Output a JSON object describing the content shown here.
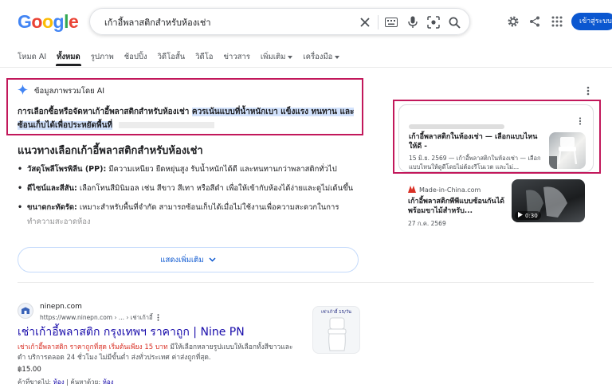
{
  "header": {
    "logo_letters": [
      {
        "ch": "G",
        "color": "#4285F4"
      },
      {
        "ch": "o",
        "color": "#EA4335"
      },
      {
        "ch": "o",
        "color": "#FBBC05"
      },
      {
        "ch": "g",
        "color": "#4285F4"
      },
      {
        "ch": "l",
        "color": "#34A853"
      },
      {
        "ch": "e",
        "color": "#EA4335"
      }
    ],
    "search_value": "เก้าอี้พลาสติกสำหรับห้องเช่า",
    "signin_label": "เข้าสู่ระบบ"
  },
  "tabs": [
    {
      "label": "โหมด AI",
      "active": false,
      "dropdown": false
    },
    {
      "label": "ทั้งหมด",
      "active": true,
      "dropdown": false
    },
    {
      "label": "รูปภาพ",
      "active": false,
      "dropdown": false
    },
    {
      "label": "ช้อปปิ้ง",
      "active": false,
      "dropdown": false
    },
    {
      "label": "วิดีโอสั้น",
      "active": false,
      "dropdown": false
    },
    {
      "label": "วิดีโอ",
      "active": false,
      "dropdown": false
    },
    {
      "label": "ข่าวสาร",
      "active": false,
      "dropdown": false
    },
    {
      "label": "เพิ่มเติม",
      "active": false,
      "dropdown": true
    },
    {
      "label": "เครื่องมือ",
      "active": false,
      "dropdown": true
    }
  ],
  "ai_overview": {
    "title": "ข้อมูลภาพรวมโดย AI",
    "text_plain": "การเลือกซื้อหรือจัดหาเก้าอี้พลาสติกสำหรับห้องเช่า ",
    "text_highlight": "ควรเน้นแบบที่น้ำหนักเบา แข็งแรง ทนทาน และซ้อนเก็บได้เพื่อประหยัดพื้นที่",
    "section_heading": "แนวทางเลือกเก้าอี้พลาสติกสำหรับห้องเช่า",
    "bullets": [
      {
        "bold": "วัสดุโพลีโพรพิลีน (PP):",
        "text": " มีความเหนียว ยืดหยุ่นสูง รับน้ำหนักได้ดี และทนทานกว่าพลาสติกทั่วไป"
      },
      {
        "bold": "ดีไซน์และสีสัน:",
        "text": " เลือกโทนสีมินิมอล เช่น สีขาว สีเทา หรือสีดำ เพื่อให้เข้ากับห้องได้ง่ายและดูไม่เด้นขึ้น"
      },
      {
        "bold": "ขนาดกะทัดรัด:",
        "text": " เหมาะสำหรับพื้นที่จำกัด สามารถซ้อนเก็บได้เมื่อไม่ใช้งานเพื่อความสะดวกในการทำความสะอาดห้อง"
      }
    ],
    "show_more_label": "แสดงเพิ่มเติม"
  },
  "cards": [
    {
      "title": "เก้าอี้พลาสติกในห้องเช่า — เลือกแบบไหนให้ดี -",
      "snippet": "15 มิ.ย. 2569 — เก้าอี้พลาสติกในห้องเช่า — เลือกแบบไหนให้ดูดีโดยไม่ต้องรีโนเวต และไม่..."
    },
    {
      "source": "Made-in-China.com",
      "title": "เก้าอี้พลาสติกพีพีแบบซ้อนกันได้พร้อมขาไม้สำหรับ...",
      "snippet": "27 ก.ค. 2569",
      "video_duration": "0:30"
    }
  ],
  "result": {
    "site_name": "ninepn.com",
    "url": "https://www.ninepn.com › ... › เช่าเก้าอี้",
    "title": "เช่าเก้าอี้พลาสติก กรุงเทพฯ ราคาถูก | Nine PN",
    "snippet_red": "เช่าเก้าอี้พลาสติก ราคาถูกที่สุด เริ่มต้นเพียง 15 บาท",
    "snippet_rest": " มีให้เลือกหลายรูปแบบให้เลือกทั้งสีขาวและดำ บริการตลอด 24 ชั่วโมง ไม่มีขั้นต่ำ ส่งทั่วประเทศ ค่าส่งถูกที่สุด.",
    "price": "฿15.00",
    "meta_prefix": "ค้าที่ขาดไป: ",
    "meta_link1": "ห้อง",
    "meta_mid": " | ค้นหาด้วย: ",
    "meta_link2": "ห้อง",
    "thumb_caption": "เช่าเก้าอี้ 15/วัน"
  },
  "colors": {
    "accent_blue": "#0b57d0",
    "link_blue": "#1a0dab",
    "highlight_box": "#c2185b",
    "ai_highlight": "#d3e3fd"
  }
}
